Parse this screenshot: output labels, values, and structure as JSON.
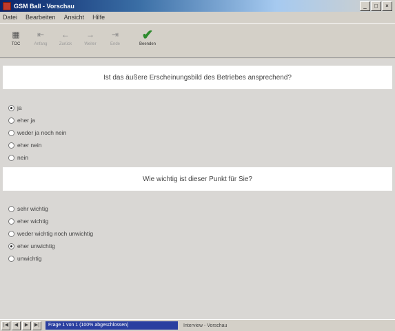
{
  "window": {
    "title": "GSM Ball - Vorschau",
    "controls": [
      "_",
      "□",
      "×"
    ]
  },
  "menu": {
    "items": [
      "Datei",
      "Bearbeiten",
      "Ansicht",
      "Hilfe"
    ]
  },
  "toolbar": {
    "buttons": [
      {
        "label": "TOC",
        "icon": "grid-icon",
        "glyph": "▦"
      },
      {
        "label": "Anfang",
        "icon": "first-icon",
        "glyph": "⇤"
      },
      {
        "label": "Zurück",
        "icon": "back-icon",
        "glyph": "←"
      },
      {
        "label": "Weiter",
        "icon": "forward-icon",
        "glyph": "→"
      },
      {
        "label": "Ende",
        "icon": "last-icon",
        "glyph": "⇥"
      },
      {
        "label": "Beenden",
        "icon": "check-icon",
        "glyph": "✔"
      }
    ]
  },
  "question1": {
    "text": "Ist das äußere Erscheinungsbild des Betriebes ansprechend?",
    "options": [
      "ja",
      "eher ja",
      "weder ja noch nein",
      "eher nein",
      "nein"
    ],
    "selected_index": 0
  },
  "question2": {
    "text": "Wie wichtig ist dieser Punkt für Sie?",
    "options": [
      "sehr wichtig",
      "eher wichtig",
      "weder wichtig noch unwichtig",
      "eher unwichtig",
      "unwichtig"
    ],
    "selected_index": 3
  },
  "status": {
    "nav": [
      "|◀",
      "◀",
      "▶",
      "▶|"
    ],
    "progress_text": "Frage 1 von 1 (100% abgeschlossen)",
    "mode_text": "Interview - Vorschau"
  }
}
